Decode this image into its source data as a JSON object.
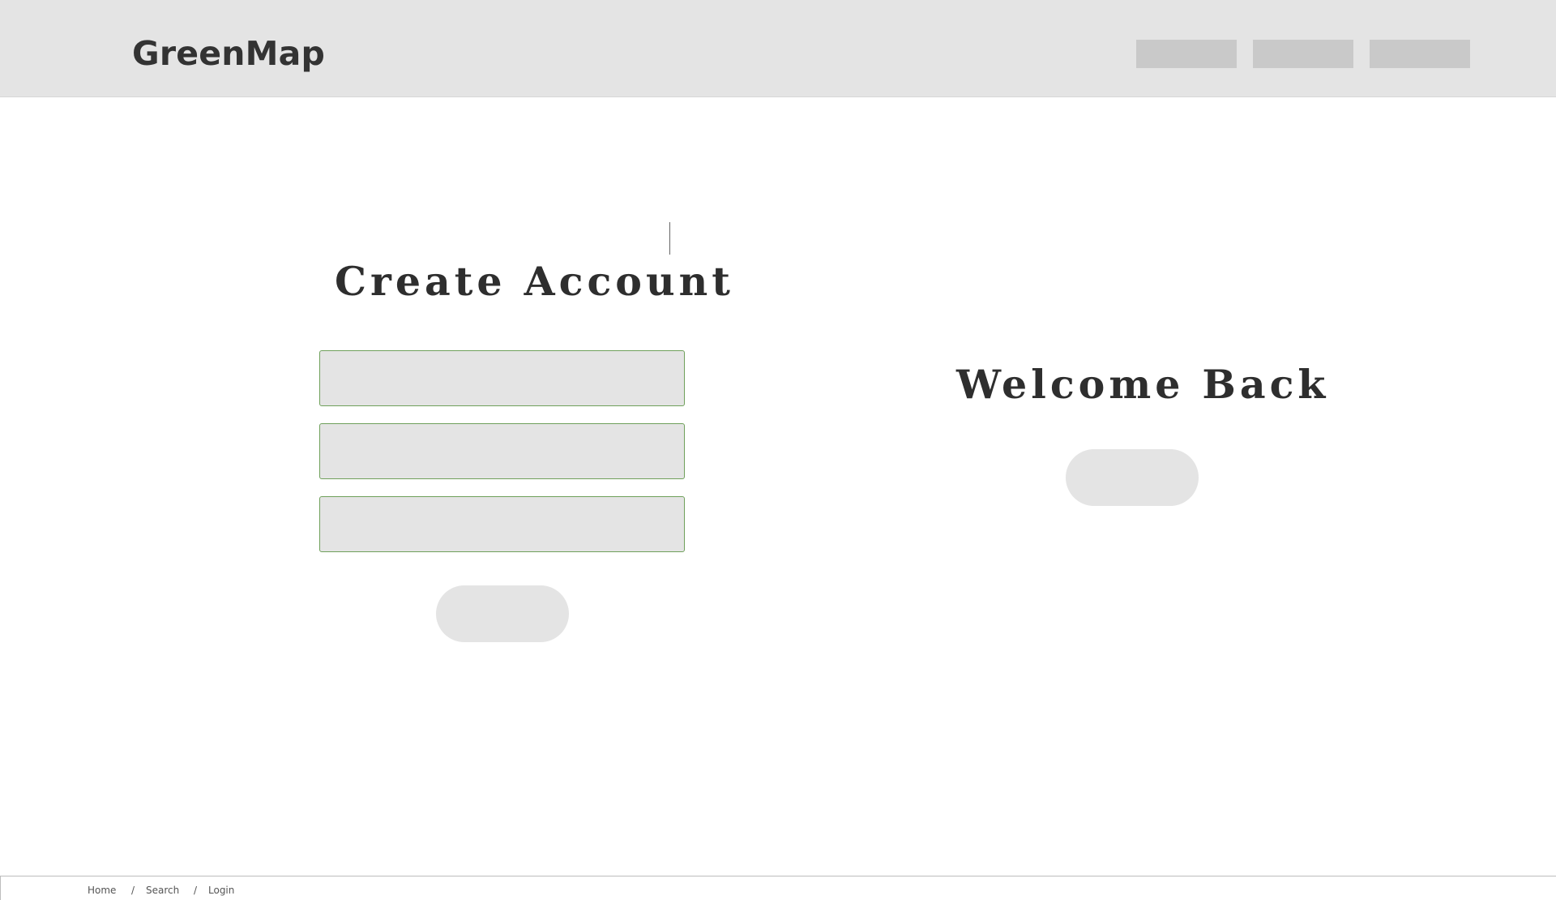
{
  "header": {
    "logo": "GreenMap",
    "nav_buttons": [
      "",
      "",
      ""
    ]
  },
  "signup": {
    "title": "Create Account",
    "fields": [
      {
        "value": "",
        "placeholder": ""
      },
      {
        "value": "",
        "placeholder": ""
      },
      {
        "value": "",
        "placeholder": ""
      }
    ],
    "button_label": ""
  },
  "signin": {
    "title": "Welcome Back",
    "button_label": ""
  },
  "breadcrumb": {
    "items": [
      "Home",
      "Search",
      "Login"
    ],
    "separator": "/"
  },
  "colors": {
    "header_bg": "#e4e4e4",
    "nav_button": "#c9c9c9",
    "field_bg": "#e4e4e4",
    "field_border": "#6fa05b",
    "heading_text": "#2e2e2e"
  }
}
